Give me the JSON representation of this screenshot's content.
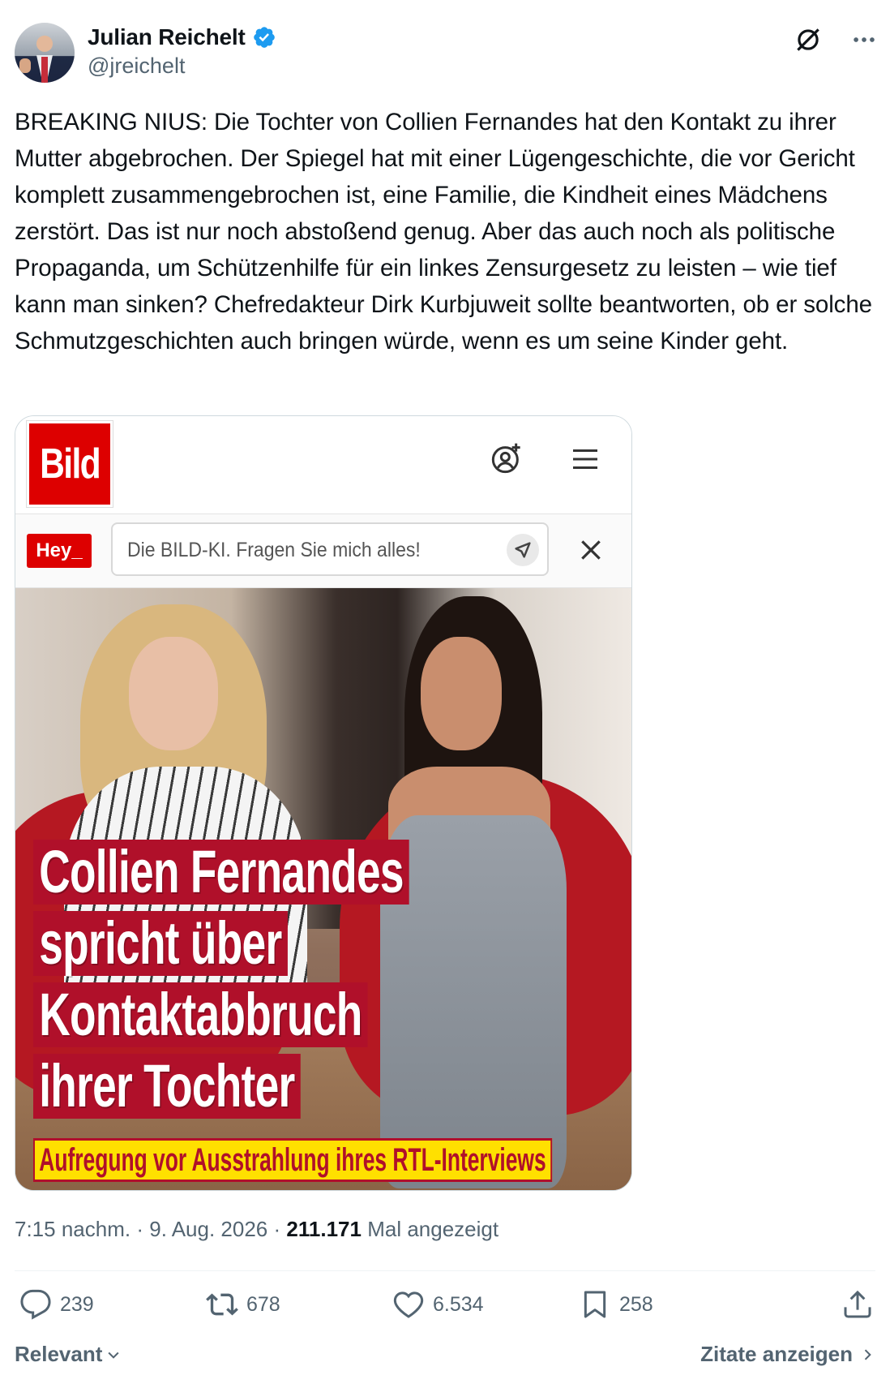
{
  "author": {
    "name": "Julian Reichelt",
    "handle": "@jreichelt",
    "verified": true
  },
  "tweet": {
    "text": "BREAKING NIUS: Die Tochter von Collien Fernandes hat den Kontakt zu ihrer Mutter abgebrochen. Der Spiegel hat mit einer Lügengeschichte, die vor Gericht komplett zusammengebrochen ist, eine Familie, die Kindheit eines Mädchens zerstört. Das ist nur noch abstoßend genug. Aber das auch noch als politische Propaganda, um Schützenhilfe für ein linkes Zensurgesetz zu leisten – wie tief kann man sinken? Chefredakteur Dirk Kurbjuweit sollte beantworten, ob er solche Schmutzgeschichten auch bringen würde, wenn es um seine Kinder geht."
  },
  "media": {
    "bild_logo": "Bild",
    "hey_badge": "Hey_",
    "search_placeholder": "Die BILD-KI. Fragen Sie mich alles!",
    "headline_lines": [
      "Collien Fernandes",
      "spricht über",
      "Kontaktabbruch",
      "ihrer Tochter"
    ],
    "subheadline": "Aufregung vor Ausstrahlung ihres RTL-Interviews"
  },
  "meta": {
    "time": "7:15 nachm.",
    "separator": "·",
    "date": "9. Aug. 2026",
    "views": "211.171",
    "views_label": "Mal angezeigt"
  },
  "actions": {
    "replies": "239",
    "reposts": "678",
    "likes": "6.534",
    "bookmarks": "258"
  },
  "footer": {
    "sort_label": "Relevant",
    "quotes_label": "Zitate anzeigen"
  },
  "colors": {
    "verified_blue": "#1d9bf0",
    "text_secondary": "#536471",
    "bild_red": "#dd0000"
  },
  "icons": [
    "verified-badge-icon",
    "grok-icon",
    "more-icon",
    "user-plus-icon",
    "menu-icon",
    "send-icon",
    "close-icon",
    "reply-icon",
    "repost-icon",
    "like-icon",
    "bookmark-icon",
    "share-icon",
    "chevron-down-icon",
    "chevron-right-icon"
  ]
}
